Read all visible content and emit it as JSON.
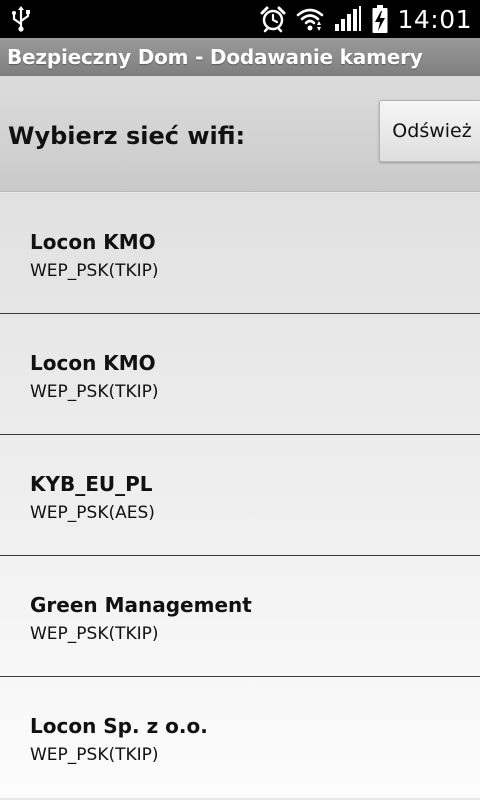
{
  "status_bar": {
    "time": "14:01",
    "icons": [
      "usb-icon",
      "alarm-icon",
      "wifi-icon",
      "signal-icon",
      "battery-charging-icon"
    ]
  },
  "title_bar": {
    "title": "Bezpieczny Dom - Dodawanie kamery"
  },
  "header": {
    "prompt": "Wybierz sieć wifi:",
    "refresh_label": "Odśwież"
  },
  "networks": [
    {
      "ssid": "Locon KMO",
      "security": "WEP_PSK(TKIP)"
    },
    {
      "ssid": "Locon KMO",
      "security": "WEP_PSK(TKIP)"
    },
    {
      "ssid": "KYB_EU_PL",
      "security": "WEP_PSK(AES)"
    },
    {
      "ssid": "Green Management",
      "security": "WEP_PSK(TKIP)"
    },
    {
      "ssid": "Locon Sp. z o.o.",
      "security": "WEP_PSK(TKIP)"
    }
  ],
  "colors": {
    "status_bar_bg": "#000000",
    "title_bar_bg": "#8a8a8a",
    "header_bg": "#d3d3d3",
    "list_bg": "#e8e8e8",
    "divider": "#3a3a3a"
  }
}
